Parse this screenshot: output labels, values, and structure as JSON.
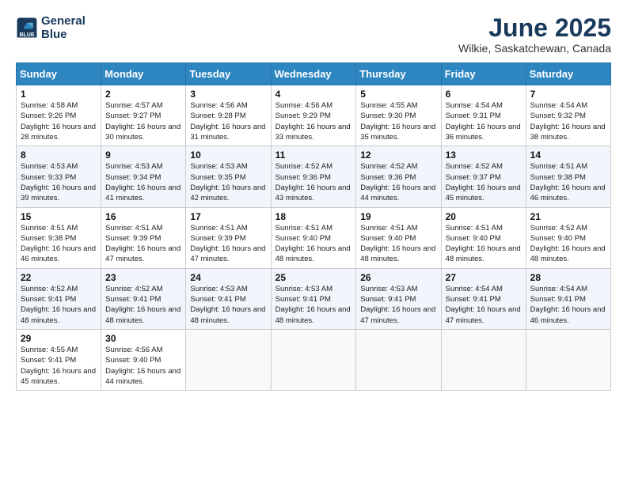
{
  "logo": {
    "line1": "General",
    "line2": "Blue"
  },
  "title": "June 2025",
  "subtitle": "Wilkie, Saskatchewan, Canada",
  "days_of_week": [
    "Sunday",
    "Monday",
    "Tuesday",
    "Wednesday",
    "Thursday",
    "Friday",
    "Saturday"
  ],
  "weeks": [
    [
      {
        "day": "1",
        "sunrise": "4:58 AM",
        "sunset": "9:26 PM",
        "daylight": "16 hours and 28 minutes."
      },
      {
        "day": "2",
        "sunrise": "4:57 AM",
        "sunset": "9:27 PM",
        "daylight": "16 hours and 30 minutes."
      },
      {
        "day": "3",
        "sunrise": "4:56 AM",
        "sunset": "9:28 PM",
        "daylight": "16 hours and 31 minutes."
      },
      {
        "day": "4",
        "sunrise": "4:56 AM",
        "sunset": "9:29 PM",
        "daylight": "16 hours and 33 minutes."
      },
      {
        "day": "5",
        "sunrise": "4:55 AM",
        "sunset": "9:30 PM",
        "daylight": "16 hours and 35 minutes."
      },
      {
        "day": "6",
        "sunrise": "4:54 AM",
        "sunset": "9:31 PM",
        "daylight": "16 hours and 36 minutes."
      },
      {
        "day": "7",
        "sunrise": "4:54 AM",
        "sunset": "9:32 PM",
        "daylight": "16 hours and 38 minutes."
      }
    ],
    [
      {
        "day": "8",
        "sunrise": "4:53 AM",
        "sunset": "9:33 PM",
        "daylight": "16 hours and 39 minutes."
      },
      {
        "day": "9",
        "sunrise": "4:53 AM",
        "sunset": "9:34 PM",
        "daylight": "16 hours and 41 minutes."
      },
      {
        "day": "10",
        "sunrise": "4:53 AM",
        "sunset": "9:35 PM",
        "daylight": "16 hours and 42 minutes."
      },
      {
        "day": "11",
        "sunrise": "4:52 AM",
        "sunset": "9:36 PM",
        "daylight": "16 hours and 43 minutes."
      },
      {
        "day": "12",
        "sunrise": "4:52 AM",
        "sunset": "9:36 PM",
        "daylight": "16 hours and 44 minutes."
      },
      {
        "day": "13",
        "sunrise": "4:52 AM",
        "sunset": "9:37 PM",
        "daylight": "16 hours and 45 minutes."
      },
      {
        "day": "14",
        "sunrise": "4:51 AM",
        "sunset": "9:38 PM",
        "daylight": "16 hours and 46 minutes."
      }
    ],
    [
      {
        "day": "15",
        "sunrise": "4:51 AM",
        "sunset": "9:38 PM",
        "daylight": "16 hours and 46 minutes."
      },
      {
        "day": "16",
        "sunrise": "4:51 AM",
        "sunset": "9:39 PM",
        "daylight": "16 hours and 47 minutes."
      },
      {
        "day": "17",
        "sunrise": "4:51 AM",
        "sunset": "9:39 PM",
        "daylight": "16 hours and 47 minutes."
      },
      {
        "day": "18",
        "sunrise": "4:51 AM",
        "sunset": "9:40 PM",
        "daylight": "16 hours and 48 minutes."
      },
      {
        "day": "19",
        "sunrise": "4:51 AM",
        "sunset": "9:40 PM",
        "daylight": "16 hours and 48 minutes."
      },
      {
        "day": "20",
        "sunrise": "4:51 AM",
        "sunset": "9:40 PM",
        "daylight": "16 hours and 48 minutes."
      },
      {
        "day": "21",
        "sunrise": "4:52 AM",
        "sunset": "9:40 PM",
        "daylight": "16 hours and 48 minutes."
      }
    ],
    [
      {
        "day": "22",
        "sunrise": "4:52 AM",
        "sunset": "9:41 PM",
        "daylight": "16 hours and 48 minutes."
      },
      {
        "day": "23",
        "sunrise": "4:52 AM",
        "sunset": "9:41 PM",
        "daylight": "16 hours and 48 minutes."
      },
      {
        "day": "24",
        "sunrise": "4:53 AM",
        "sunset": "9:41 PM",
        "daylight": "16 hours and 48 minutes."
      },
      {
        "day": "25",
        "sunrise": "4:53 AM",
        "sunset": "9:41 PM",
        "daylight": "16 hours and 48 minutes."
      },
      {
        "day": "26",
        "sunrise": "4:53 AM",
        "sunset": "9:41 PM",
        "daylight": "16 hours and 47 minutes."
      },
      {
        "day": "27",
        "sunrise": "4:54 AM",
        "sunset": "9:41 PM",
        "daylight": "16 hours and 47 minutes."
      },
      {
        "day": "28",
        "sunrise": "4:54 AM",
        "sunset": "9:41 PM",
        "daylight": "16 hours and 46 minutes."
      }
    ],
    [
      {
        "day": "29",
        "sunrise": "4:55 AM",
        "sunset": "9:41 PM",
        "daylight": "16 hours and 45 minutes."
      },
      {
        "day": "30",
        "sunrise": "4:56 AM",
        "sunset": "9:40 PM",
        "daylight": "16 hours and 44 minutes."
      },
      null,
      null,
      null,
      null,
      null
    ]
  ]
}
